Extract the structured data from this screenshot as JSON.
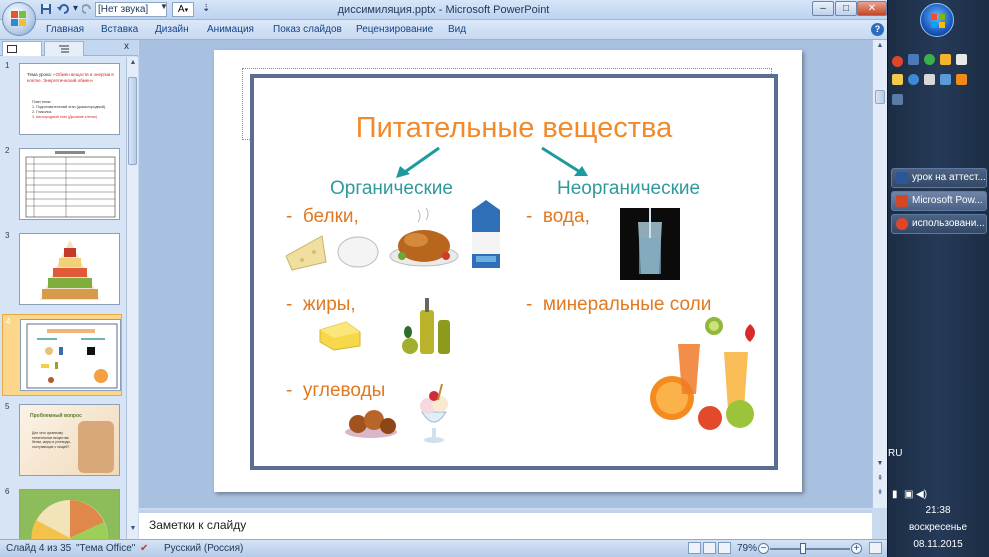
{
  "window": {
    "title": "диссимиляция.pptx - Microsoft PowerPoint",
    "sound_select": "[Нет звука]",
    "font_button": "A",
    "minimize": "–",
    "restore": "□",
    "close": "✕"
  },
  "ribbon": {
    "tabs": [
      "Главная",
      "Вставка",
      "Дизайн",
      "Анимация",
      "Показ слайдов",
      "Рецензирование",
      "Вид"
    ],
    "help": "?"
  },
  "panel": {
    "close": "x",
    "slides": [
      {
        "num": "1",
        "title_prefix": "Тема урока:",
        "title": "«Обмен веществ и энергии в клетке. Энергетический обмен»",
        "plan": "План темы:",
        "plan_items": [
          "1. Подготовительный этап (докислородный).",
          "2. Гликолиз.",
          "3. Кислородный этап (Дыхание клетки)"
        ]
      },
      {
        "num": "2",
        "table_rows": 8
      },
      {
        "num": "3"
      },
      {
        "num": "4"
      },
      {
        "num": "5",
        "text_title": "Проблемный вопрос",
        "text_body": "Для чего организму питательные вещества: белки, жиры и углеводы, поступающие с пищей?"
      },
      {
        "num": "6"
      }
    ],
    "selected_index": 3
  },
  "slide": {
    "title": "Питательные вещества",
    "organic": {
      "heading": "Органические",
      "items": [
        "белки,",
        "жиры,",
        "углеводы"
      ]
    },
    "inorganic": {
      "heading": "Неорганические",
      "items": [
        "вода,",
        "минеральные соли"
      ]
    },
    "bullet": "-",
    "colors": {
      "title": "#f08a2a",
      "subtitle": "#2f9a9c",
      "items": "#e0791f",
      "frame": "#5a6e92"
    }
  },
  "notes": {
    "placeholder": "Заметки к слайду"
  },
  "status": {
    "slide_counter": "Слайд 4 из 35",
    "theme": "\"Тема Office\"",
    "language": "Русский (Россия)",
    "zoom": "79%"
  },
  "taskbar": {
    "tasks": [
      "урок на аттест...",
      "Microsoft Pow...",
      "использовани..."
    ],
    "language": "RU",
    "time": "21:38",
    "day": "воскресенье",
    "date": "08.11.2015"
  }
}
